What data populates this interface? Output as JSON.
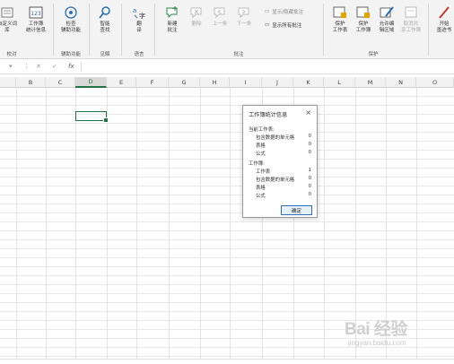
{
  "ribbon": {
    "buttons": {
      "custom_dict": "自定义词库",
      "workbook_stats_line1": "工作簿",
      "workbook_stats_line2": "统计信息",
      "check_access_line1": "检查",
      "check_access_line2": "辅助功能",
      "smart_lookup_line1": "智能",
      "smart_lookup_line2": "查找",
      "translate_line1": "翻",
      "translate_line2": "译",
      "new_comment_line1": "新建",
      "new_comment_line2": "批注",
      "delete": "删除",
      "previous": "上一条",
      "next": "下一条",
      "show_hide_comment": "显示/隐藏批注",
      "show_all_comments": "显示所有批注",
      "protect_sheet_line1": "保护",
      "protect_sheet_line2": "工作表",
      "protect_workbook_line1": "保护",
      "protect_workbook_line2": "工作簿",
      "allow_edit_line1": "允许编",
      "allow_edit_line2": "辑区域",
      "unshare_line1": "取消共",
      "unshare_line2": "享工作簿",
      "start_ink_line1": "开始",
      "start_ink_line2": "墨迹书"
    },
    "groups": {
      "proofing": "校对",
      "accessibility": "辅助功能",
      "insights": "见解",
      "language": "语言",
      "comments": "批注",
      "protect": "保护"
    }
  },
  "formula_bar": {
    "fx": "fx"
  },
  "columns": [
    "B",
    "C",
    "D",
    "E",
    "F",
    "G",
    "H",
    "I",
    "J",
    "K",
    "L",
    "M",
    "N",
    "O"
  ],
  "selected_column": "D",
  "dialog": {
    "title": "工作簿统计信息",
    "current_sheet_heading": "当前工作表:",
    "current_sheet_rows": [
      {
        "label": "包含数据的单元格",
        "value": "0"
      },
      {
        "label": "表格",
        "value": "0"
      },
      {
        "label": "公式",
        "value": "0"
      }
    ],
    "workbook_heading": "工作簿:",
    "workbook_rows": [
      {
        "label": "工作表",
        "value": "1"
      },
      {
        "label": "包含数据的单元格",
        "value": "0"
      },
      {
        "label": "表格",
        "value": "0"
      },
      {
        "label": "公式",
        "value": "0"
      }
    ],
    "ok_label": "确定"
  },
  "watermark": {
    "logo": "Bai 经验",
    "sub": "jingyan.baidu.com"
  },
  "colors": {
    "accent": "#217346",
    "dialog_button_border": "#2f6fb3"
  }
}
